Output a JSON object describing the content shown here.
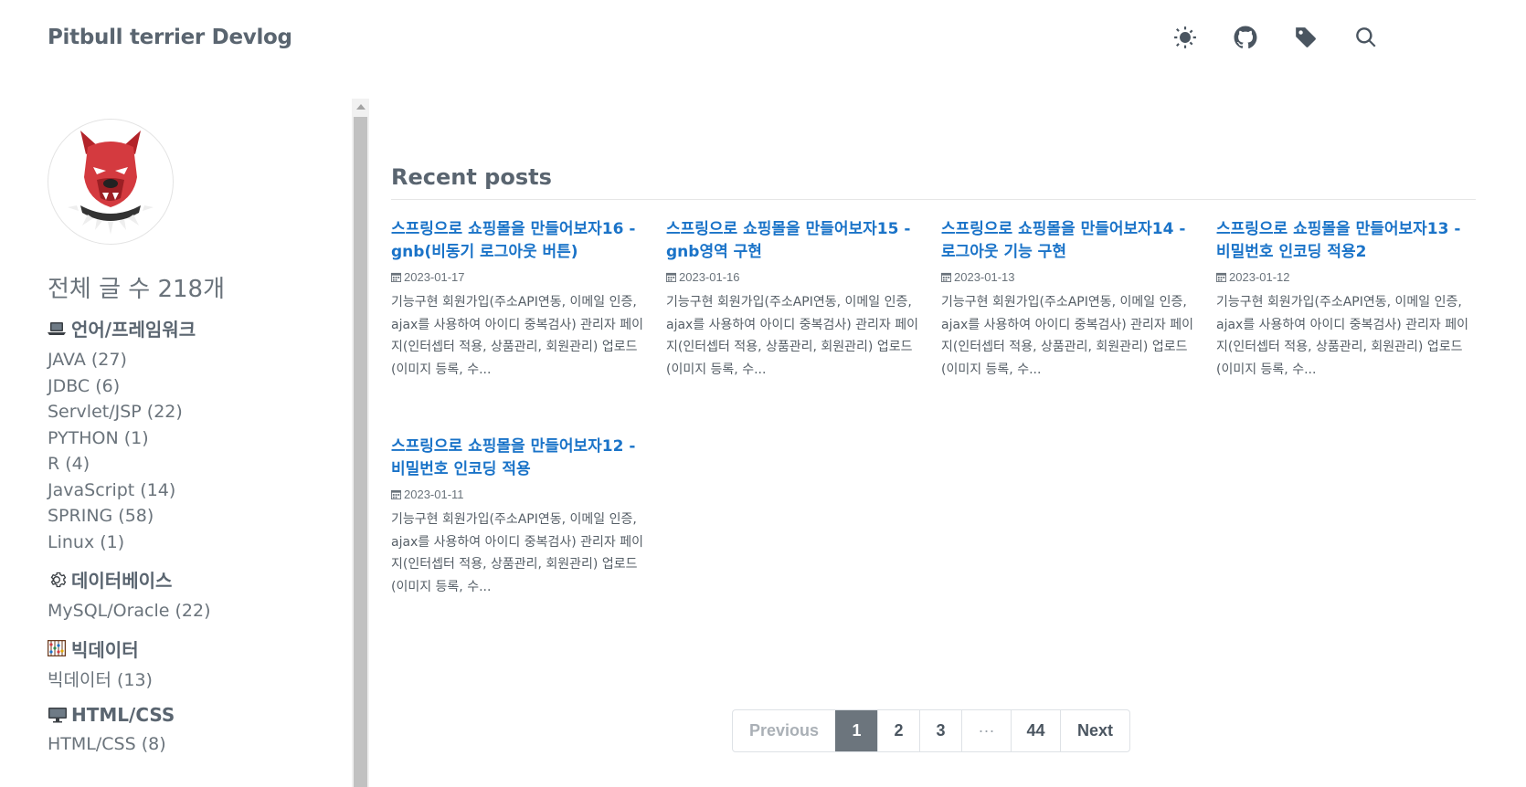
{
  "header": {
    "site_title": "Pitbull terrier Devlog",
    "icons": [
      "theme-toggle-icon",
      "github-icon",
      "tag-icon",
      "search-icon"
    ]
  },
  "sidebar": {
    "post_count": "전체 글 수 218개",
    "groups": [
      {
        "icon": "laptop-icon",
        "title": "언어/프레임워크",
        "items": [
          "JAVA (27)",
          "JDBC (6)",
          "Servlet/JSP (22)",
          "PYTHON (1)",
          "R (4)",
          "JavaScript (14)",
          "SPRING (58)",
          "Linux (1)"
        ]
      },
      {
        "icon": "gear-icon",
        "title": "데이터베이스",
        "items": [
          "MySQL/Oracle (22)"
        ]
      },
      {
        "icon": "abacus-icon",
        "title": "빅데이터",
        "items": [
          "빅데이터 (13)"
        ]
      },
      {
        "icon": "desktop-icon",
        "title": "HTML/CSS",
        "items": [
          "HTML/CSS (8)"
        ]
      }
    ]
  },
  "main": {
    "heading": "Recent posts",
    "posts": [
      {
        "title": "스프링으로 쇼핑몰을 만들어보자16 - gnb(비동기 로그아웃 버튼)",
        "date": "2023-01-17",
        "excerpt": "기능구현 회원가입(주소API연동, 이메일 인증, ajax를 사용하여 아이디 중복검사) 관리자 페이지(인터셉터 적용, 상품관리, 회원관리) 업로드(이미지 등록, 수..."
      },
      {
        "title": "스프링으로 쇼핑몰을 만들어보자15 - gnb영역 구현",
        "date": "2023-01-16",
        "excerpt": "기능구현 회원가입(주소API연동, 이메일 인증, ajax를 사용하여 아이디 중복검사) 관리자 페이지(인터셉터 적용, 상품관리, 회원관리) 업로드(이미지 등록, 수..."
      },
      {
        "title": "스프링으로 쇼핑몰을 만들어보자14 - 로그아웃 기능 구현",
        "date": "2023-01-13",
        "excerpt": "기능구현 회원가입(주소API연동, 이메일 인증, ajax를 사용하여 아이디 중복검사) 관리자 페이지(인터셉터 적용, 상품관리, 회원관리) 업로드(이미지 등록, 수..."
      },
      {
        "title": "스프링으로 쇼핑몰을 만들어보자13 - 비밀번호 인코딩 적용2",
        "date": "2023-01-12",
        "excerpt": "기능구현 회원가입(주소API연동, 이메일 인증, ajax를 사용하여 아이디 중복검사) 관리자 페이지(인터셉터 적용, 상품관리, 회원관리) 업로드(이미지 등록, 수..."
      },
      {
        "title": "스프링으로 쇼핑몰을 만들어보자12 - 비밀번호 인코딩 적용",
        "date": "2023-01-11",
        "excerpt": "기능구현 회원가입(주소API연동, 이메일 인증, ajax를 사용하여 아이디 중복검사) 관리자 페이지(인터셉터 적용, 상품관리, 회원관리) 업로드(이미지 등록, 수..."
      }
    ]
  },
  "pagination": {
    "previous": "Previous",
    "pages": [
      "1",
      "2",
      "3"
    ],
    "ellipsis": "···",
    "last": "44",
    "next": "Next",
    "current": "1"
  },
  "colors": {
    "link": "#1a73c8",
    "text": "#5a6570",
    "active_page": "#6c757d"
  }
}
